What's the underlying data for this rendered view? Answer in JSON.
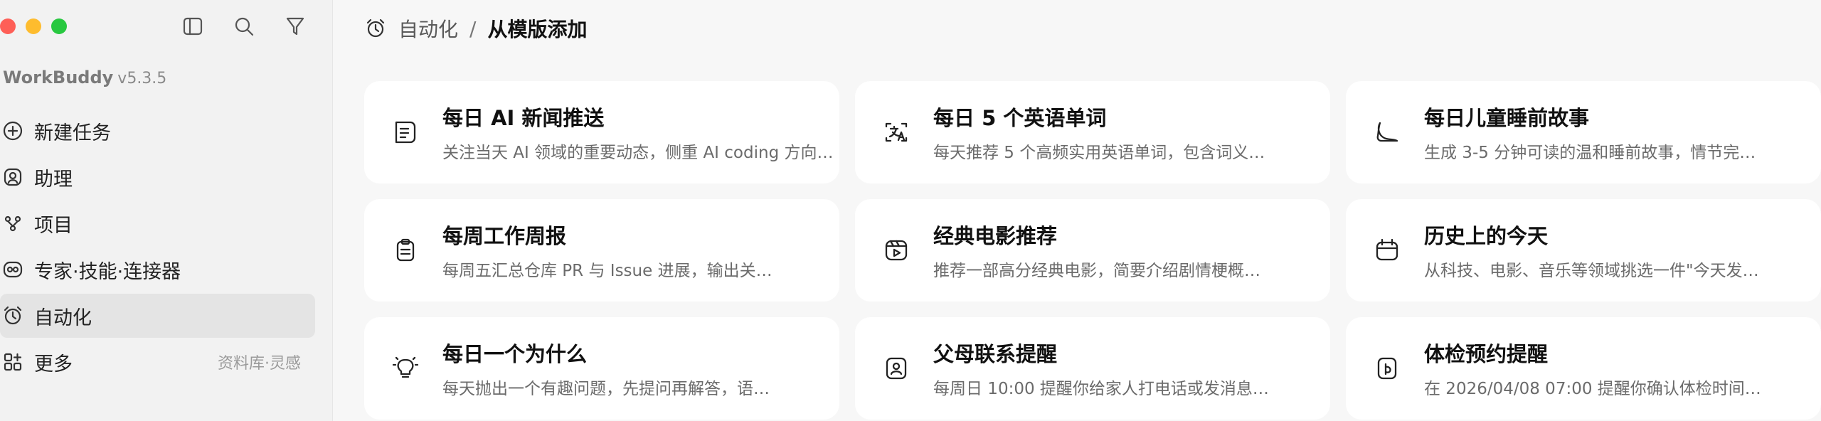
{
  "sidebar": {
    "brand": {
      "name": "WorkBuddy",
      "version": "v5.3.5"
    },
    "items": [
      {
        "label": "新建任务",
        "icon": "plus-circle-icon"
      },
      {
        "label": "助理",
        "icon": "assistant-icon"
      },
      {
        "label": "项目",
        "icon": "project-icon"
      },
      {
        "label": "专家·技能·连接器",
        "icon": "expert-icon"
      },
      {
        "label": "自动化",
        "icon": "alarm-clock-icon",
        "active": true
      },
      {
        "label": "更多",
        "icon": "apps-icon",
        "extra": "资料库·灵感"
      }
    ]
  },
  "breadcrumb": {
    "parent": "自动化",
    "separator": "/",
    "current": "从模版添加"
  },
  "templates": [
    {
      "title": "每日 AI 新闻推送",
      "desc": "关注当天 AI 领域的重要动态，侧重 AI coding 方向…",
      "icon": "news-icon"
    },
    {
      "title": "每日 5 个英语单词",
      "desc": "每天推荐 5 个高频实用英语单词，包含词义…",
      "icon": "translate-icon"
    },
    {
      "title": "每日儿童睡前故事",
      "desc": "生成 3-5 分钟可读的温和睡前故事，情节完…",
      "icon": "moon-icon"
    },
    {
      "title": "每周工作周报",
      "desc": "每周五汇总仓库 PR 与 Issue 进展，输出关…",
      "icon": "clipboard-icon"
    },
    {
      "title": "经典电影推荐",
      "desc": "推荐一部高分经典电影，简要介绍剧情梗概…",
      "icon": "movie-icon"
    },
    {
      "title": "历史上的今天",
      "desc": "从科技、电影、音乐等领域挑选一件\"今天发…",
      "icon": "calendar-icon"
    },
    {
      "title": "每日一个为什么",
      "desc": "每天抛出一个有趣问题，先提问再解答，语…",
      "icon": "lightbulb-icon"
    },
    {
      "title": "父母联系提醒",
      "desc": "每周日 10:00 提醒你给家人打电话或发消息…",
      "icon": "contact-icon"
    },
    {
      "title": "体检预约提醒",
      "desc": "在 2026/04/08 07:00 提醒你确认体检时间…",
      "icon": "health-icon"
    }
  ]
}
